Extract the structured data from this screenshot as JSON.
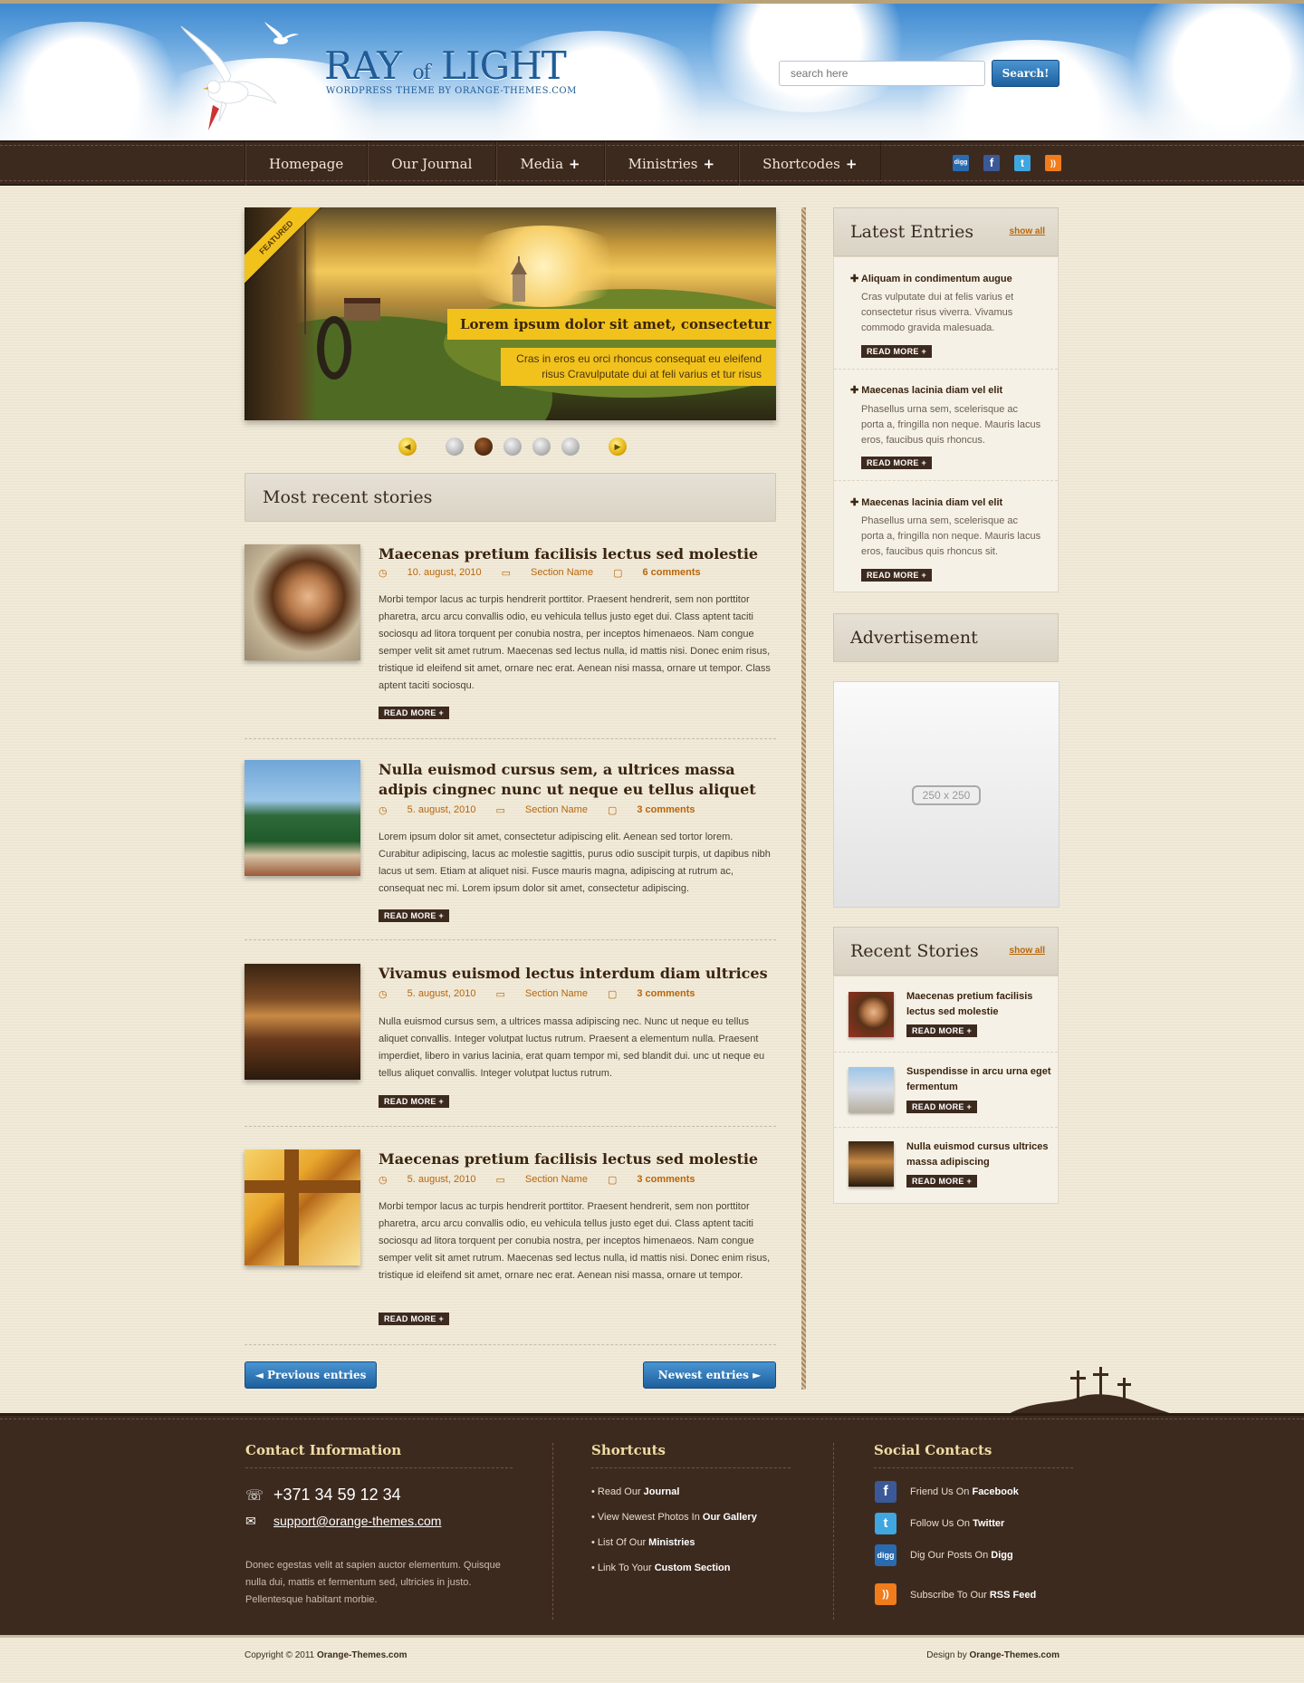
{
  "header": {
    "logo_title_a": "RAY",
    "logo_title_of": "of",
    "logo_title_b": "LIGHT",
    "logo_subtitle": "WORDPRESS THEME BY ORANGE-THEMES.COM",
    "search_placeholder": "search here",
    "search_button": "Search!"
  },
  "nav": {
    "items": [
      {
        "label": "Homepage",
        "has_sub": false
      },
      {
        "label": "Our Journal",
        "has_sub": false
      },
      {
        "label": "Media",
        "has_sub": true
      },
      {
        "label": "Ministries",
        "has_sub": true
      },
      {
        "label": "Shortcodes",
        "has_sub": true
      }
    ],
    "plus": "+",
    "social": [
      {
        "icon": "digg-icon",
        "text": "digg",
        "color": "#2a6bb0"
      },
      {
        "icon": "facebook-icon",
        "text": "f",
        "color": "#3b5998"
      },
      {
        "icon": "twitter-icon",
        "text": "t",
        "color": "#3fa6df"
      },
      {
        "icon": "rss-icon",
        "text": "))",
        "color": "#f07c1b"
      }
    ]
  },
  "slider": {
    "badge": "FEATURED",
    "title": "Lorem ipsum dolor sit amet, consectetur",
    "text": "Cras in eros eu orci rhoncus consequat eu eleifend risus Cravulputate dui at feli varius et tur risus",
    "prev": "◀",
    "next": "▶",
    "dots": 5,
    "active_dot": 2
  },
  "main": {
    "section_title": "Most recent stories",
    "read_more": "READ MORE +",
    "posts": [
      {
        "title": "Maecenas pretium facilisis lectus sed molestie",
        "date": "10. august, 2010",
        "section": "Section Name",
        "comments": "6 comments",
        "body": "Morbi tempor lacus ac turpis hendrerit porttitor. Praesent hendrerit, sem non porttitor pharetra, arcu arcu convallis odio, eu vehicula tellus justo eget dui. Class aptent taciti sociosqu ad litora torquent per conubia nostra, per inceptos himenaeos. Nam congue semper velit sit amet rutrum. Maecenas sed lectus nulla, id mattis nisi. Donec enim risus, tristique id eleifend sit amet, ornare nec erat. Aenean nisi massa, ornare ut tempor. Class aptent taciti sociosqu."
      },
      {
        "title": "Nulla euismod cursus sem, a ultrices massa adipis cingnec nunc ut neque eu tellus aliquet",
        "date": "5. august, 2010",
        "section": "Section Name",
        "comments": "3 comments",
        "body": "Lorem ipsum dolor sit amet, consectetur adipiscing elit. Aenean sed tortor lorem. Curabitur adipiscing, lacus ac molestie sagittis, purus odio suscipit turpis, ut dapibus nibh lacus ut sem. Etiam at aliquet nisi. Fusce mauris magna, adipiscing at rutrum ac, consequat nec mi. Lorem ipsum dolor sit amet, consectetur adipiscing."
      },
      {
        "title": "Vivamus euismod lectus interdum diam ultrices",
        "date": "5. august, 2010",
        "section": "Section Name",
        "comments": "3 comments",
        "body": "Nulla euismod cursus sem, a ultrices massa adipiscing nec. Nunc ut neque eu tellus aliquet convallis. Integer volutpat luctus rutrum. Praesent a elementum nulla. Praesent imperdiet, libero in varius lacinia, erat quam tempor mi, sed blandit dui. unc ut neque eu tellus aliquet convallis. Integer volutpat luctus rutrum."
      },
      {
        "title": "Maecenas pretium facilisis lectus sed molestie",
        "date": "5. august, 2010",
        "section": "Section Name",
        "comments": "3 comments",
        "body": "Morbi tempor lacus ac turpis hendrerit porttitor. Praesent hendrerit, sem non porttitor pharetra, arcu arcu convallis odio, eu vehicula tellus justo eget dui. Class aptent taciti sociosqu ad litora torquent per conubia nostra, per inceptos himenaeos. Nam congue semper velit sit amet rutrum. Maecenas sed lectus nulla, id mattis nisi. Donec enim risus, tristique id eleifend sit amet, ornare nec erat. Aenean nisi massa, ornare ut tempor."
      }
    ],
    "prev_button": "◄  Previous entries",
    "next_button": "Newest entries  ►"
  },
  "sidebar": {
    "latest": {
      "title": "Latest Entries",
      "show_all": "show all",
      "items": [
        {
          "title": "Aliquam in condimentum augue",
          "text": "Cras vulputate dui at felis varius et consectetur risus viverra. Vivamus commodo gravida malesuada."
        },
        {
          "title": "Maecenas lacinia diam vel elit",
          "text": "Phasellus urna sem, scelerisque ac porta a, fringilla non neque. Mauris lacus eros, faucibus quis rhoncus."
        },
        {
          "title": "Maecenas lacinia diam vel elit",
          "text": "Phasellus urna sem, scelerisque ac porta a, fringilla non neque. Mauris lacus eros, faucibus quis rhoncus sit."
        }
      ]
    },
    "ad": {
      "title": "Advertisement",
      "size_label": "250 x 250"
    },
    "recent": {
      "title": "Recent Stories",
      "show_all": "show all",
      "items": [
        {
          "title": "Maecenas pretium facilisis lectus sed molestie"
        },
        {
          "title": "Suspendisse in arcu urna eget fermentum"
        },
        {
          "title": "Nulla euismod cursus ultrices massa adipiscing"
        }
      ]
    },
    "read_more": "READ MORE +"
  },
  "footer": {
    "contact": {
      "title": "Contact Information",
      "phone": "+371 34 59 12 34",
      "email": "support@orange-themes.com",
      "text": "Donec egestas velit at sapien auctor elementum. Quisque nulla dui, mattis et fermentum sed, ultricies in justo. Pellentesque habitant morbie."
    },
    "shortcuts": {
      "title": "Shortcuts",
      "items": [
        {
          "pre": "Read Our ",
          "bold": "Journal"
        },
        {
          "pre": "View Newest Photos In ",
          "bold": "Our Gallery"
        },
        {
          "pre": "List Of Our ",
          "bold": "Ministries"
        },
        {
          "pre": "Link To Your ",
          "bold": "Custom Section"
        }
      ]
    },
    "social": {
      "title": "Social Contacts",
      "items": [
        {
          "icon": "facebook-icon",
          "glyph": "f",
          "color": "#3b5998",
          "pre": "Friend Us On ",
          "bold": "Facebook"
        },
        {
          "icon": "twitter-icon",
          "glyph": "t",
          "color": "#3fa6df",
          "pre": "Follow Us On ",
          "bold": "Twitter"
        },
        {
          "icon": "digg-icon",
          "glyph": "digg",
          "color": "#2a6bb0",
          "pre": "Dig Our Posts On ",
          "bold": "Digg"
        },
        {
          "icon": "rss-icon",
          "glyph": "))",
          "color": "#f07c1b",
          "pre": "Subscribe To Our  ",
          "bold": "RSS Feed"
        }
      ]
    },
    "copyright_pre": "Copyright © 2011 ",
    "copyright_bold": "Orange-Themes.com",
    "design_pre": "Design by ",
    "design_bold": "Orange-Themes.com"
  }
}
